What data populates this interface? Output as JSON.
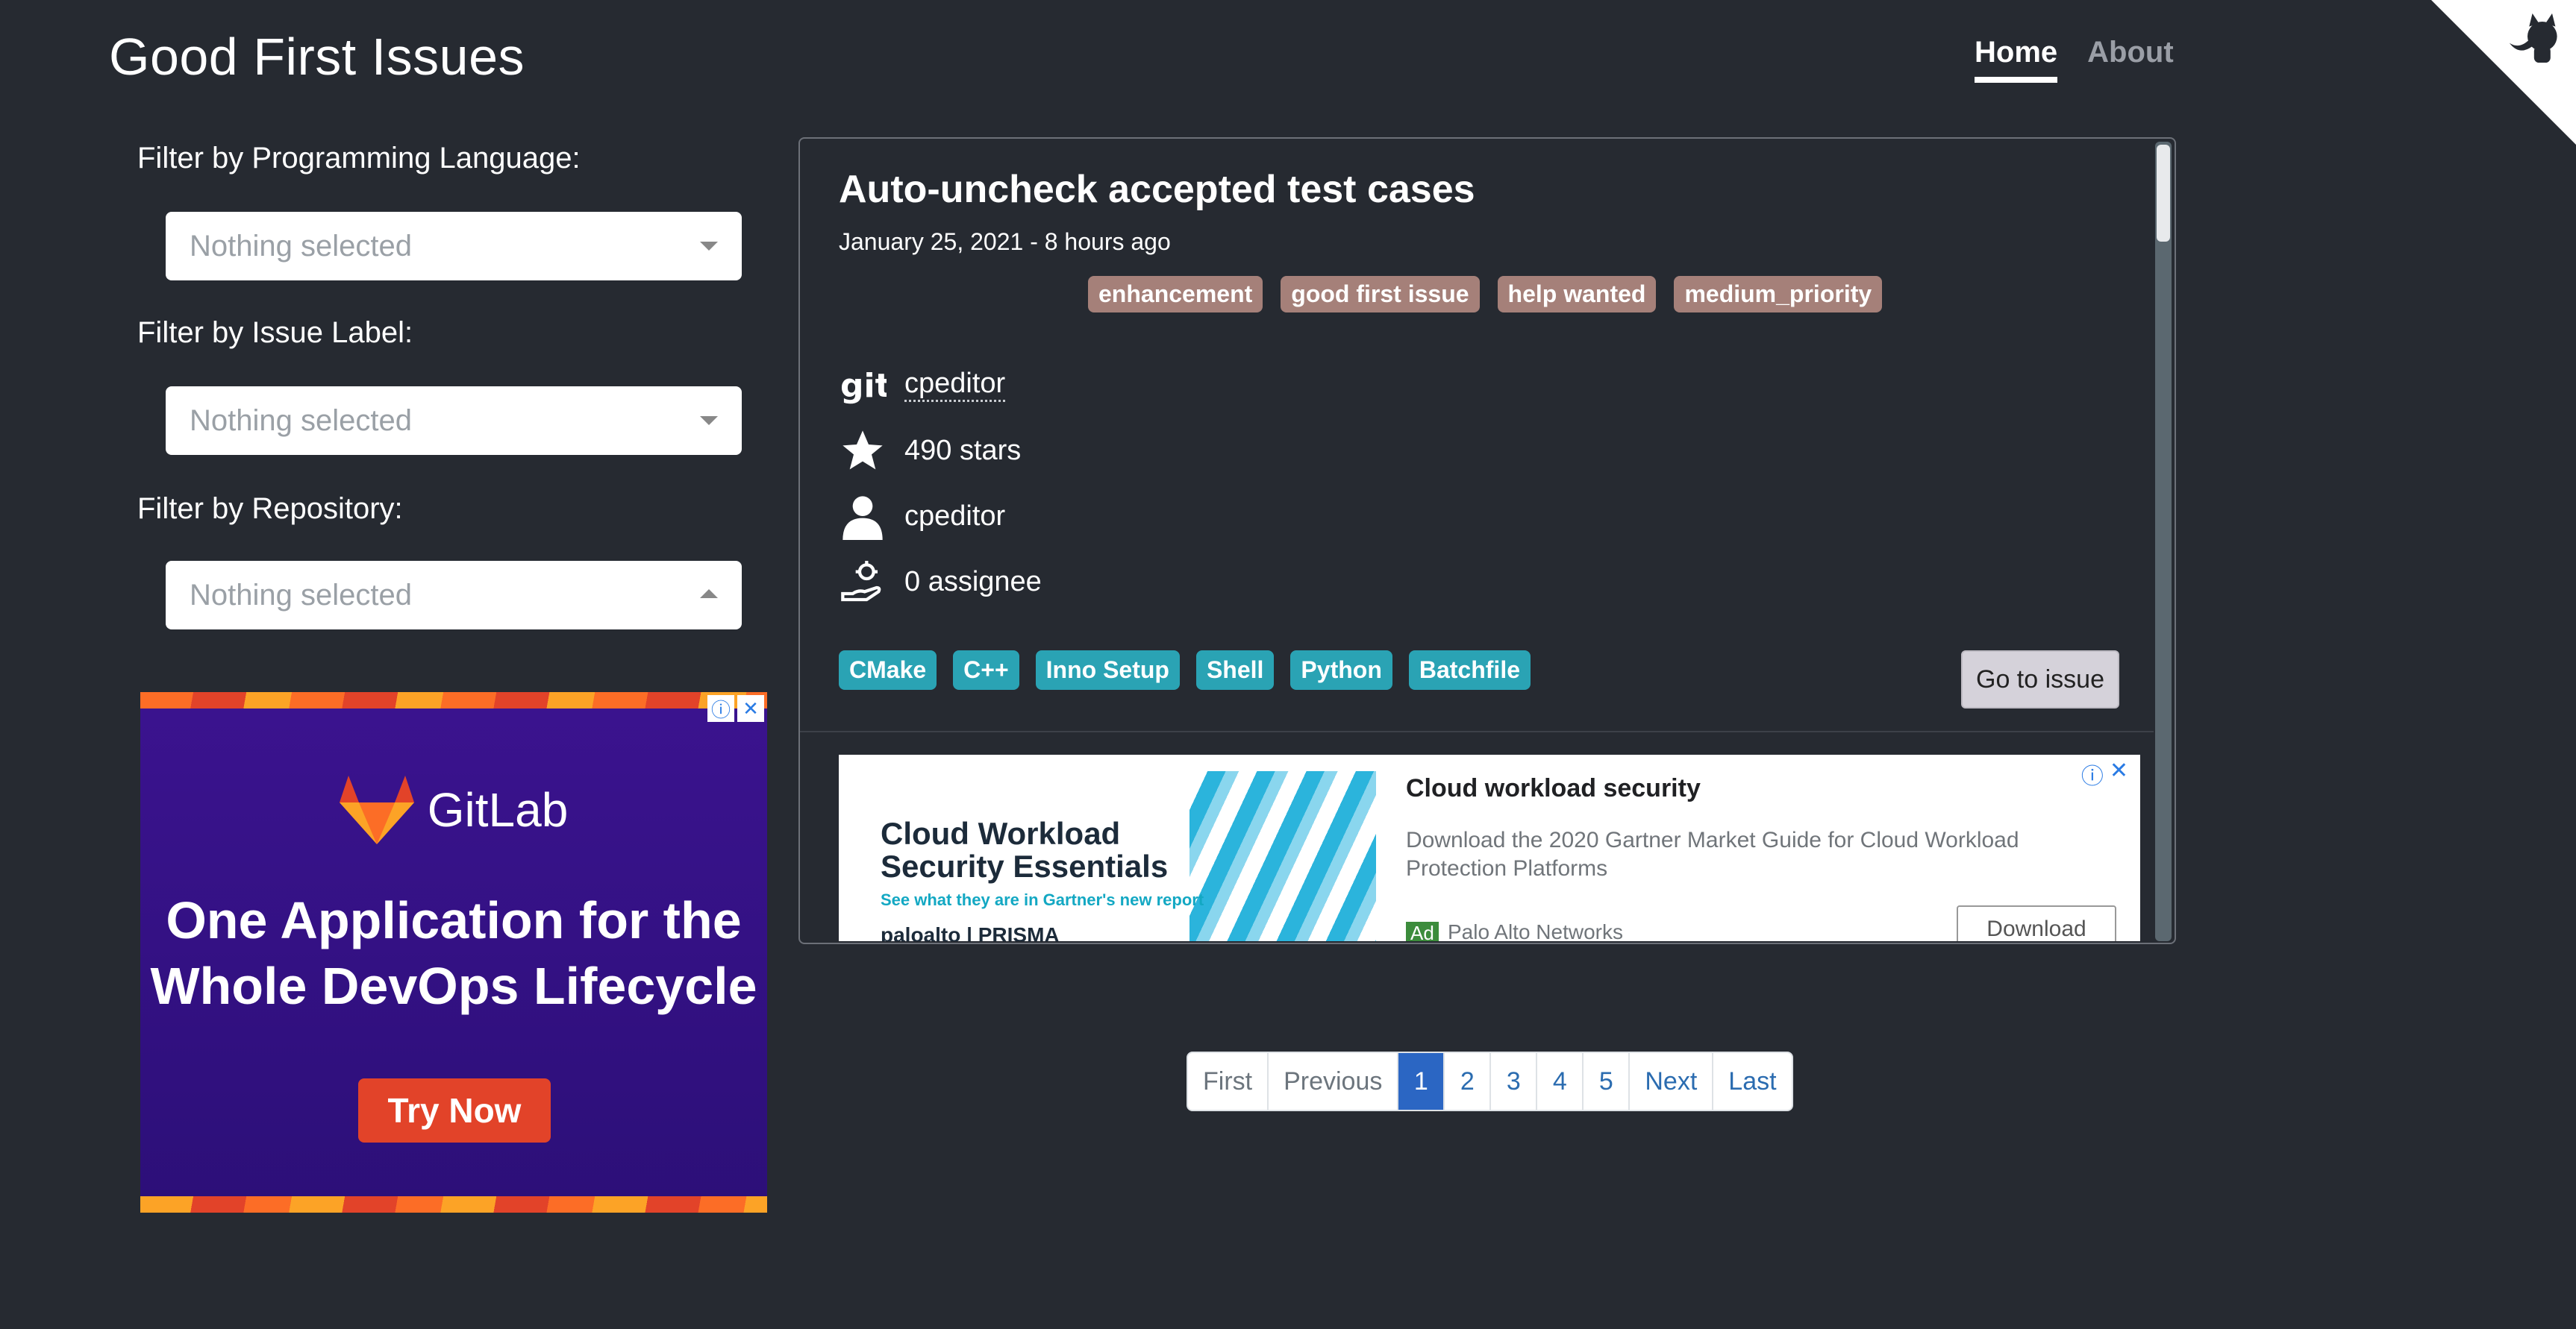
{
  "header": {
    "title": "Good First Issues",
    "nav": [
      {
        "label": "Home",
        "active": true
      },
      {
        "label": "About",
        "active": false
      }
    ]
  },
  "filters": {
    "language": {
      "label": "Filter by Programming Language:",
      "value": "Nothing selected"
    },
    "issue_label": {
      "label": "Filter by Issue Label:",
      "value": "Nothing selected"
    },
    "repository": {
      "label": "Filter by Repository:",
      "value": "Nothing selected"
    }
  },
  "ad_left": {
    "brand": "GitLab",
    "headline": "One Application for the Whole DevOps Lifecycle",
    "cta": "Try Now",
    "colors": {
      "background": "#2c0f78",
      "cta": "#e24329"
    }
  },
  "issue": {
    "title": "Auto-uncheck accepted test cases",
    "date": "January 25, 2021 - 8 hours ago",
    "labels": [
      "enhancement",
      "good first issue",
      "help wanted",
      "medium_priority"
    ],
    "repo": "cpeditor",
    "stars": "490 stars",
    "owner": "cpeditor",
    "assignees": "0 assignee",
    "languages": [
      "CMake",
      "C++",
      "Inno Setup",
      "Shell",
      "Python",
      "Batchfile"
    ],
    "goto_label": "Go to issue"
  },
  "ad_inline": {
    "art_title": "Cloud Workload Security Essentials",
    "art_subtitle": "See what they are in Gartner's new report",
    "art_brand": "paloalto | PRISMA",
    "headline": "Cloud workload security",
    "description": "Download the 2020 Gartner Market Guide for Cloud Workload Protection Platforms",
    "badge": "Ad",
    "advertiser": "Palo Alto Networks",
    "cta": "Download"
  },
  "pagination": {
    "items": [
      "First",
      "Previous",
      "1",
      "2",
      "3",
      "4",
      "5",
      "Next",
      "Last"
    ],
    "active_page": "1"
  },
  "colors": {
    "background": "#262a31",
    "label_pill": "#a58079",
    "language_pill": "#2aa3b4",
    "page_active": "#2b66c3"
  }
}
